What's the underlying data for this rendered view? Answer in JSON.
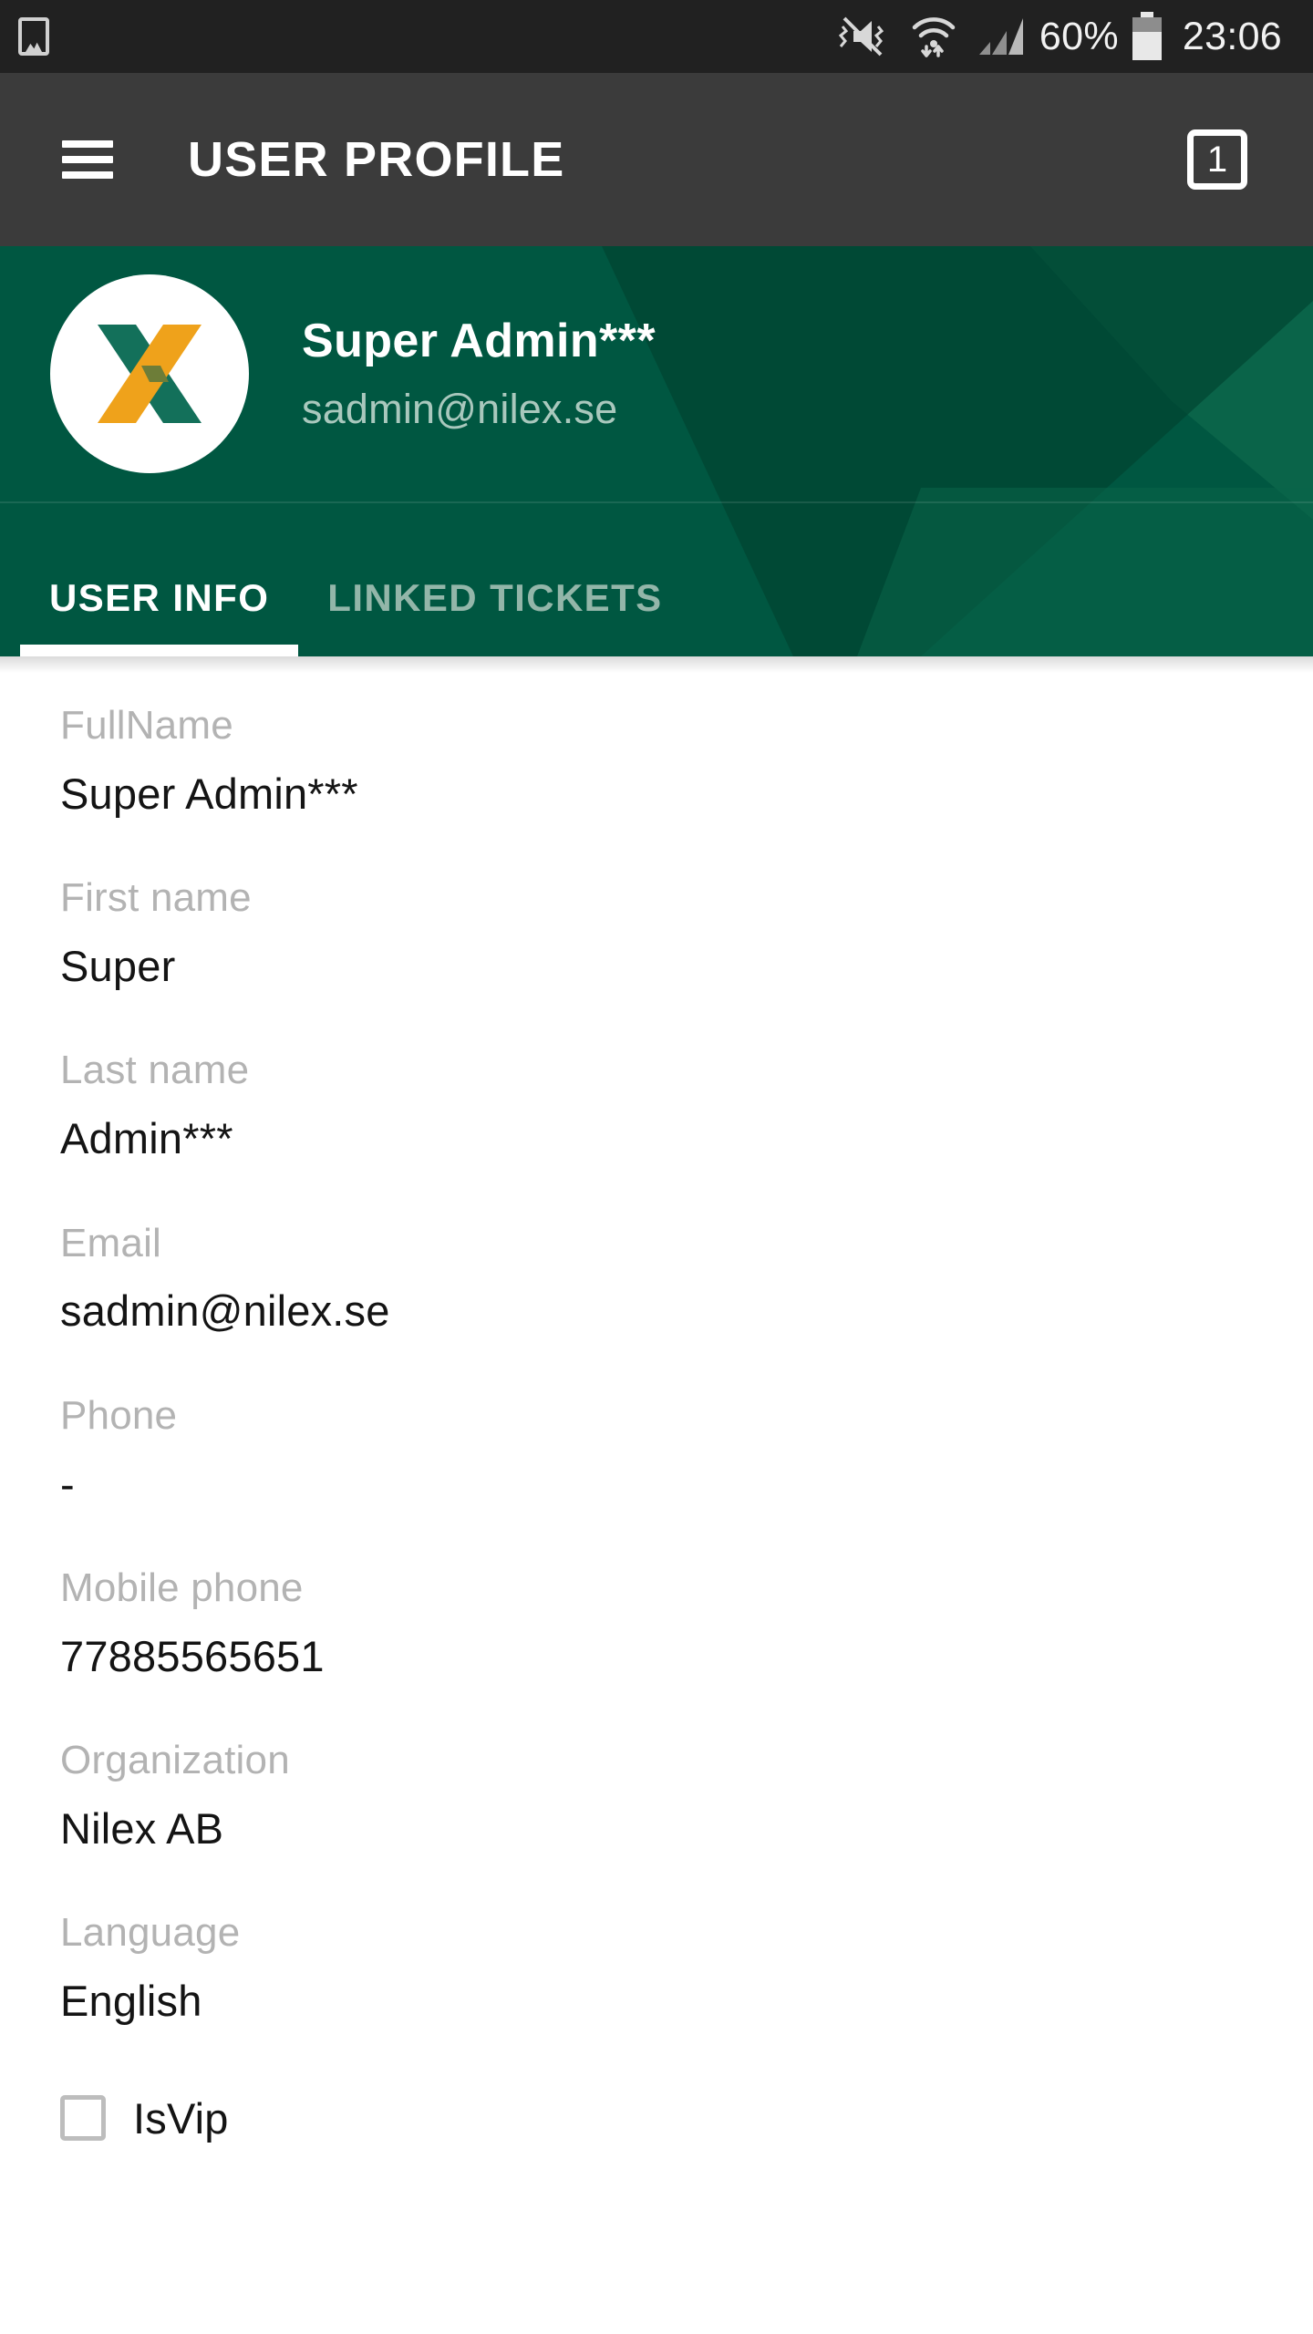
{
  "status_bar": {
    "left_icon": "gallery-image-icon",
    "icons": [
      "sound-off-vibrate-icon",
      "wifi-icon",
      "cellular-signal-icon"
    ],
    "battery_percent": "60%",
    "battery_icon": "battery-icon",
    "clock": "23:06"
  },
  "app_bar": {
    "menu_icon": "hamburger-menu-icon",
    "title": "USER PROFILE",
    "tab_count": "1"
  },
  "profile": {
    "avatar_icon": "nilex-x-logo",
    "name": "Super Admin***",
    "email": "sadmin@nilex.se"
  },
  "tabs": [
    {
      "label": "USER INFO",
      "active": true
    },
    {
      "label": "LINKED TICKETS",
      "active": false
    }
  ],
  "user_info": {
    "fields": [
      {
        "label": "FullName",
        "value": "Super Admin***"
      },
      {
        "label": "First name",
        "value": "Super"
      },
      {
        "label": "Last name",
        "value": "Admin***"
      },
      {
        "label": "Email",
        "value": "sadmin@nilex.se"
      },
      {
        "label": "Phone",
        "value": "-"
      },
      {
        "label": "Mobile phone",
        "value": "77885565651"
      },
      {
        "label": "Organization",
        "value": "Nilex AB"
      },
      {
        "label": "Language",
        "value": "English"
      }
    ],
    "checkbox": {
      "label": "IsVip",
      "checked": false
    }
  },
  "colors": {
    "status_bar": "#212121",
    "app_bar": "#3b3b3b",
    "brand_green": "#005741",
    "brand_green_dark": "#00402f",
    "brand_green_light": "#0a6449",
    "logo_green": "#13705a",
    "logo_orange": "#efa21b",
    "label_gray": "#b3b3b3",
    "value_black": "#141414",
    "tab_inactive": "#93b6a9"
  }
}
